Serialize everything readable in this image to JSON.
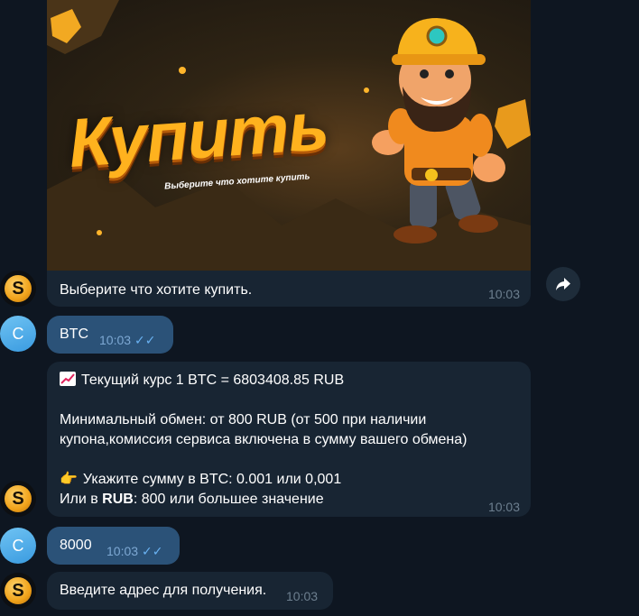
{
  "messages": {
    "banner": {
      "title": "Купить",
      "subtitle": "Выберите что хотите купить",
      "caption": "Выберите что хотите купить.",
      "time": "10:03"
    },
    "user1": {
      "avatar_letter": "C",
      "text": "BTC",
      "time": "10:03"
    },
    "rate": {
      "line1": "Текущий курс 1 BTC = 6803408.85 RUB",
      "line2": "Минимальный обмен: от 800 RUB (от 500 при наличии",
      "line3": "купона,комиссия сервиса включена в сумму вашего обмена)",
      "line4": "Укажите сумму в BTC: 0.001 или 0,001",
      "line5_prefix": "Или в ",
      "line5_bold": "RUB",
      "line5_suffix": ": 800 или большее значение",
      "time": "10:03"
    },
    "user2": {
      "avatar_letter": "C",
      "text": "8000",
      "time": "10:03"
    },
    "address": {
      "text": "Введите адрес для получения.",
      "time": "10:03"
    }
  },
  "bot_avatar_letter": "S",
  "icons": {
    "share": "share-arrow-icon",
    "read": "double-check-icon",
    "chart": "chart-increasing-icon",
    "point": "pointing-hand-icon"
  },
  "colors": {
    "background": "#0e1621",
    "incoming_bubble": "#182533",
    "outgoing_bubble": "#2b5278",
    "check": "#6ab2f2"
  }
}
